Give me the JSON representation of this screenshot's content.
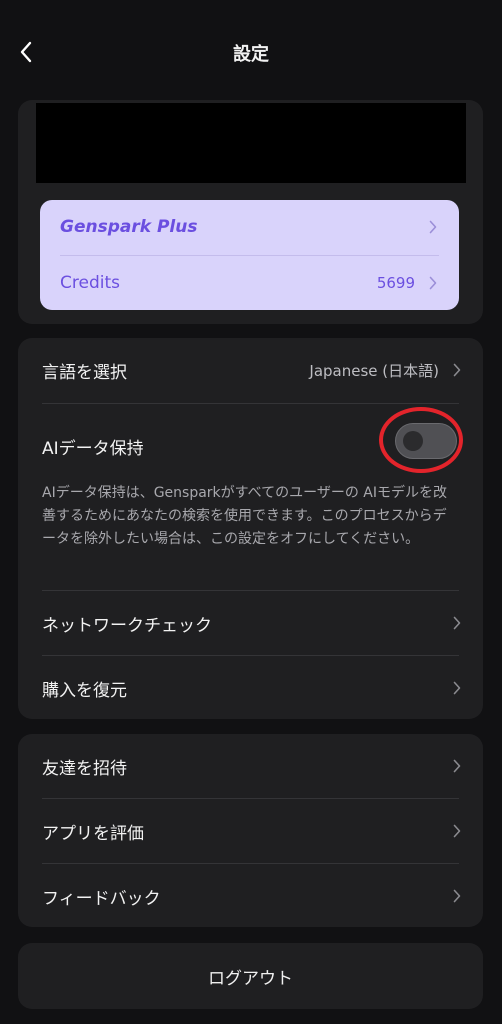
{
  "header": {
    "title": "設定",
    "back_icon": "chevron-left-icon"
  },
  "account": {
    "plan": {
      "name": "Genspark Plus",
      "credits_label": "Credits",
      "credits_value": "5699"
    }
  },
  "settings": {
    "language": {
      "label": "言語を選択",
      "value": "Japanese (日本語)"
    },
    "ai_data": {
      "label": "AIデータ保持",
      "enabled": false,
      "description": "AIデータ保持は、Gensparkがすべてのユーザーの AIモデルを改善するためにあなたの検索を使用できます。このプロセスからデータを除外したい場合は、この設定をオフにしてください。"
    },
    "network_check": {
      "label": "ネットワークチェック"
    },
    "restore_purchase": {
      "label": "購入を復元"
    }
  },
  "social": {
    "invite": {
      "label": "友達を招待"
    },
    "rate_app": {
      "label": "アプリを評価"
    },
    "feedback": {
      "label": "フィードバック"
    }
  },
  "logout": {
    "label": "ログアウト"
  },
  "colors": {
    "background": "#111113",
    "card": "#1f1f21",
    "plan_bg": "#d9d3fb",
    "plan_text": "#6b4fe0",
    "highlight_circle": "#e3242b"
  }
}
